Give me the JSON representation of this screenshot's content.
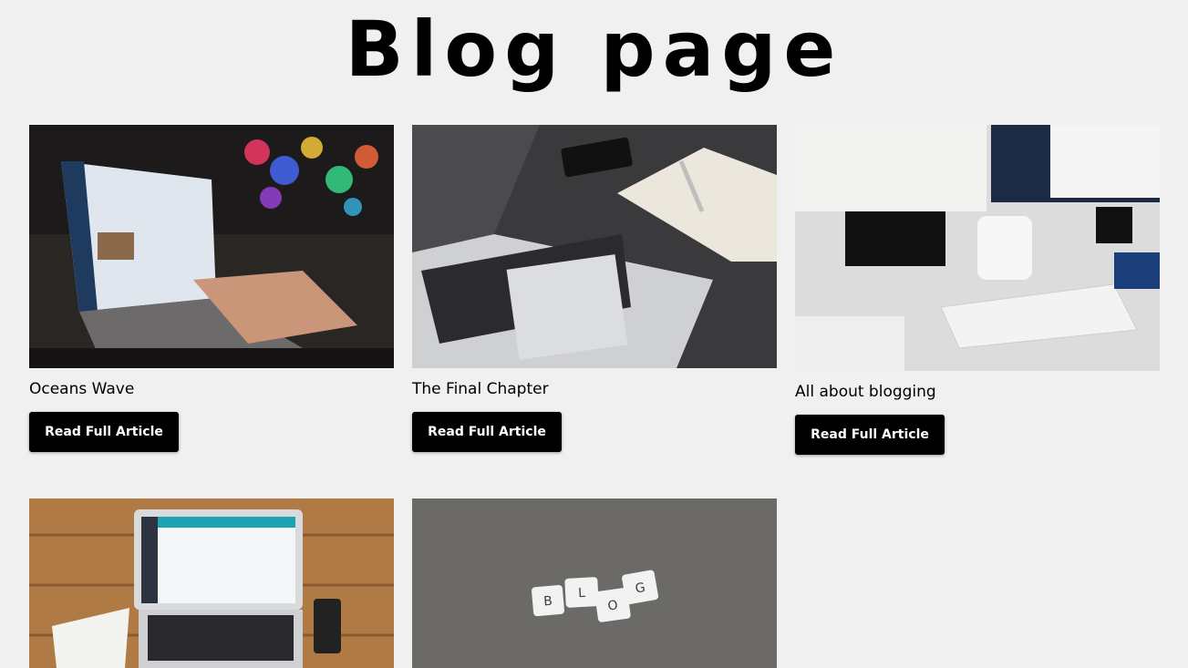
{
  "page": {
    "title": "Blog page"
  },
  "posts": [
    {
      "title": "Oceans Wave",
      "button_label": "Read Full Article",
      "image": "laptop-typing-photo"
    },
    {
      "title": "The Final Chapter",
      "button_label": "Read Full Article",
      "image": "laptop-notebook-photo"
    },
    {
      "title": "All about blogging",
      "button_label": "Read Full Article",
      "image": "desk-monitors-photo"
    },
    {
      "title": "",
      "button_label": "",
      "image": "laptop-wood-desk-photo"
    },
    {
      "title": "",
      "button_label": "",
      "image": "blog-tiles-photo",
      "image_text": [
        "B",
        "L",
        "O",
        "G"
      ]
    }
  ],
  "colors": {
    "background": "#f0f0f0",
    "button": "#000000",
    "button_text": "#ffffff"
  }
}
